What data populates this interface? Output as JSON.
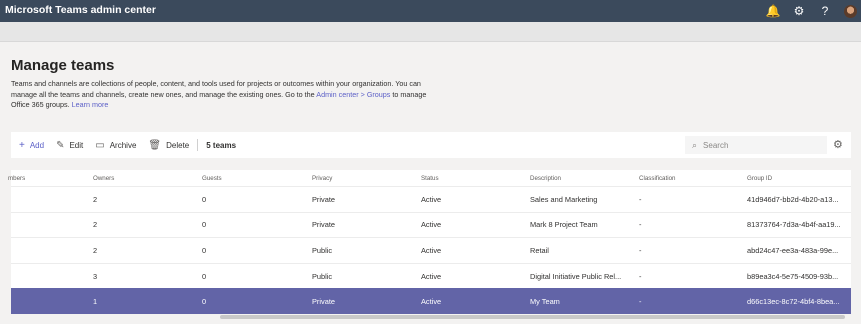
{
  "header": {
    "app_title": "Microsoft Teams admin center",
    "bell": "🔔",
    "gear": "⚙",
    "help": "?"
  },
  "page": {
    "title": "Manage teams",
    "desc_text": "Teams and channels are collections of people, content, and tools used for projects or outcomes within your organization. You can manage all the teams and channels, create new ones, and manage the existing ones. Go to the ",
    "desc_link1": "Admin center > Groups",
    "desc_mid": " to manage Office 365 groups. ",
    "desc_link2": "Learn more"
  },
  "toolbar": {
    "add_label": "Add",
    "edit_label": "Edit",
    "archive_label": "Archive",
    "delete_label": "Delete",
    "team_count": "5 teams",
    "search_placeholder": "Search"
  },
  "table": {
    "columns": [
      "mbers",
      "Owners",
      "Guests",
      "Privacy",
      "Status",
      "Description",
      "Classification",
      "Group ID"
    ],
    "rows": [
      {
        "owners": "2",
        "guests": "0",
        "privacy": "Private",
        "status": "Active",
        "description": "Sales and Marketing",
        "classification": "-",
        "group_id": "41d946d7-bb2d-4b20-a13..."
      },
      {
        "owners": "2",
        "guests": "0",
        "privacy": "Private",
        "status": "Active",
        "description": "Mark 8 Project Team",
        "classification": "-",
        "group_id": "81373764-7d3a-4b4f-aa19..."
      },
      {
        "owners": "2",
        "guests": "0",
        "privacy": "Public",
        "status": "Active",
        "description": "Retail",
        "classification": "-",
        "group_id": "abd24c47-ee3a-483a-99e..."
      },
      {
        "owners": "3",
        "guests": "0",
        "privacy": "Public",
        "status": "Active",
        "description": "Digital Initiative Public Rel...",
        "classification": "-",
        "group_id": "b89ea3c4-5e75-4509-93b..."
      },
      {
        "owners": "1",
        "guests": "0",
        "privacy": "Private",
        "status": "Active",
        "description": "My Team",
        "classification": "-",
        "group_id": "d66c13ec-8c72-4bf4-8bea..."
      }
    ]
  },
  "colors": {
    "accent": "#6264a7",
    "topbar": "#3b4a5c"
  }
}
